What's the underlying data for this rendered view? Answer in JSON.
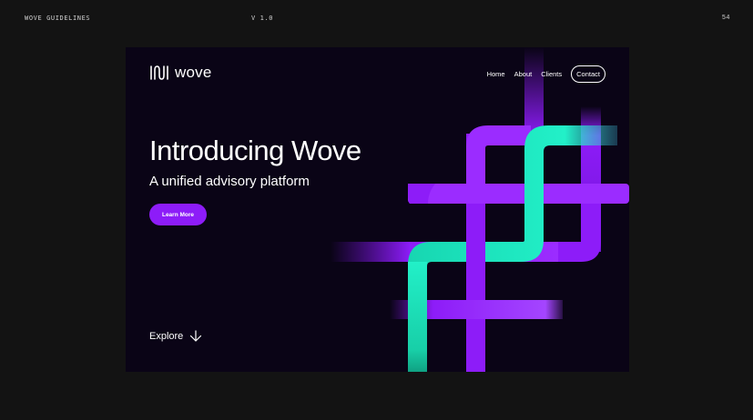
{
  "guide": {
    "title": "WOVE GUIDELINES",
    "version": "V 1.0",
    "page_number": "54"
  },
  "brand": {
    "name": "wove",
    "icon": "wave-lines-logo"
  },
  "nav": {
    "items": [
      "Home",
      "About",
      "Clients"
    ],
    "contact_label": "Contact"
  },
  "hero": {
    "title": "Introducing Wove",
    "subtitle": "A unified advisory platform",
    "cta_label": "Learn More",
    "explore_label": "Explore",
    "explore_icon": "arrow-down-icon"
  },
  "colors": {
    "page_bg": "#131313",
    "slide_bg": "#0a0416",
    "accent_purple": "#8d1cf8",
    "accent_mint": "#1ee8c0",
    "text": "#ffffff"
  }
}
